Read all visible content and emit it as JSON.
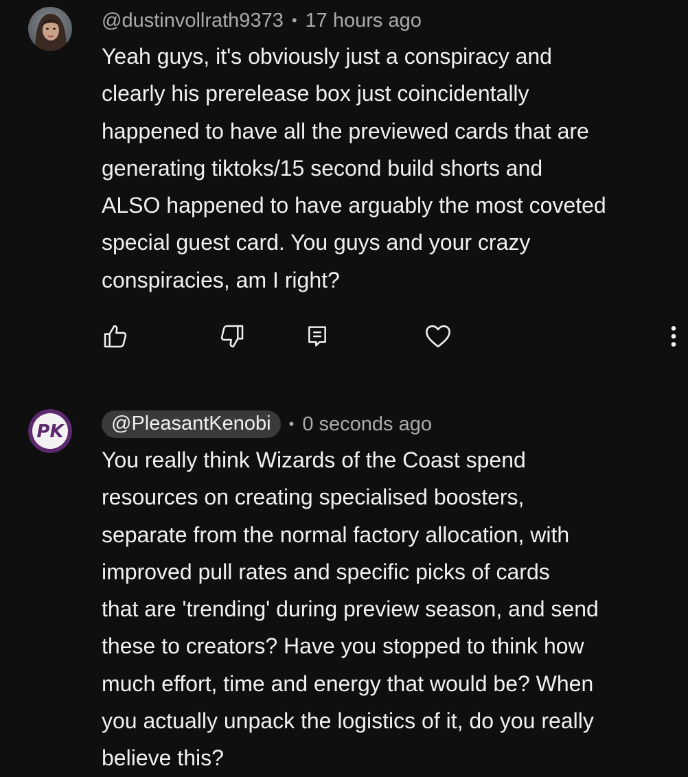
{
  "comments": [
    {
      "author": "@dustinvollrath9373",
      "time": "17 hours ago",
      "lines": [
        "Yeah guys, it's obviously just a conspiracy and",
        "clearly his prerelease box just coincidentally",
        "happened to have all the previewed cards that are",
        "generating tiktoks/15 second build shorts and",
        "ALSO happened to have arguably the most coveted",
        "special guest card. You guys and your crazy",
        "conspiracies, am I right?"
      ]
    },
    {
      "author": "@PleasantKenobi",
      "time": "0 seconds ago",
      "avatar_text": "PK",
      "lines": [
        "You really think Wizards of the Coast spend",
        "resources on creating specialised boosters,",
        "separate from the normal factory allocation, with",
        "improved pull rates and specific picks of cards",
        "that are 'trending' during preview season, and send",
        "these to creators? Have you stopped to think how",
        "much effort, time and energy that would be? When",
        "you actually unpack the logistics of it, do you really",
        "believe this?"
      ]
    }
  ],
  "separator": "•",
  "icons": {
    "like": "thumbs-up-icon",
    "dislike": "thumbs-down-icon",
    "reply": "reply-icon",
    "heart": "heart-icon",
    "more": "more-vertical-icon"
  },
  "colors": {
    "background": "#0f0f0f",
    "text": "#f1f1f1",
    "meta": "#aaaaaa",
    "pill": "#3a3a3a",
    "avatar_purple": "#5b2a6e"
  }
}
